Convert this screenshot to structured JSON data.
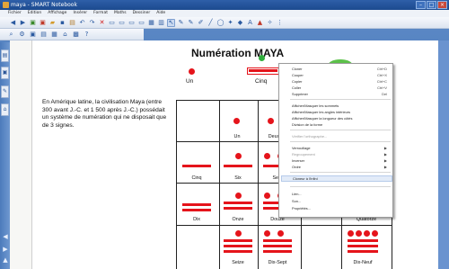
{
  "window": {
    "title": "maya - SMART Notebook"
  },
  "menubar": [
    "Fichier",
    "Edition",
    "Affichage",
    "Insérer",
    "Format",
    "Maths",
    "Dessiner",
    "Aide"
  ],
  "toolbar1_icons": [
    "back-icon",
    "forward-icon",
    "add-page-icon",
    "delete-page-icon",
    "open-icon",
    "save-icon",
    "paste-icon",
    "undo-icon",
    "redo-icon",
    "delete-icon",
    "screen-shade-icon",
    "fullscreen-icon",
    "dual-page-icon",
    "document-camera-icon",
    "table-icon",
    "properties-icon",
    "select-icon",
    "pen-icon",
    "creative-pen-icon",
    "eraser-icon",
    "line-icon",
    "shape-icon",
    "magic-pen-icon",
    "fill-icon",
    "text-icon",
    "measure-icon",
    "compass-icon",
    "more-icon"
  ],
  "toolbar2_icons": [
    "zoom-icon",
    "tools-icon",
    "capture-icon",
    "page-sorter-icon",
    "gallery-icon",
    "attachments-icon",
    "property-icon",
    "help-icon"
  ],
  "sidebar": {
    "tabs": [
      "pages-tab",
      "gallery-tab",
      "attachments-tab",
      "properties-tab"
    ]
  },
  "page": {
    "title": "Numération MAYA",
    "top_labels": {
      "un": "Un",
      "cinq": "Cinq"
    },
    "body": "En Amérique latine, la civilisation Maya (entre 300 avant J.-C. et 1 500 après J.-C.) possédait un système de numération qui ne disposait que de 3 signes.",
    "cells": {
      "r1c2": "Un",
      "r1c3": "Deux",
      "r2c1": "Cinq",
      "r2c2": "Six",
      "r2c3": "Sept",
      "r3c1": "Dix",
      "r3c2": "Onze",
      "r3c3": "Douze",
      "r3c5": "Quatorze",
      "r4c2": "Seize",
      "r4c3": "Dix-Sept",
      "r4c5": "Dix-Neuf"
    }
  },
  "context_menu": {
    "items": [
      {
        "label": "Cloner",
        "shortcut": "Ctrl+D"
      },
      {
        "label": "Couper",
        "shortcut": "Ctrl+X"
      },
      {
        "label": "Copier",
        "shortcut": "Ctrl+C"
      },
      {
        "label": "Coller",
        "shortcut": "Ctrl+V"
      },
      {
        "label": "Supprimer",
        "shortcut": "Del"
      },
      {
        "label": "Afficher/Masquer les sommets"
      },
      {
        "label": "Afficher/Masquer les angles intérieurs"
      },
      {
        "label": "Afficher/Masquer la longueur des côtés"
      },
      {
        "label": "Division de la forme"
      },
      {
        "label": "Vérifier l'orthographe..."
      },
      {
        "label": "Verrouillage"
      },
      {
        "label": "Regroupement"
      },
      {
        "label": "Inverser"
      },
      {
        "label": "Ordre"
      },
      {
        "label": "Cloneur à l'infini"
      },
      {
        "label": "Lien..."
      },
      {
        "label": "Son..."
      },
      {
        "label": "Propriétés..."
      }
    ]
  },
  "colors": {
    "maya_red": "#e5141b",
    "handle_green": "#2fae3c",
    "chrome_blue": "#2e5fa8"
  }
}
